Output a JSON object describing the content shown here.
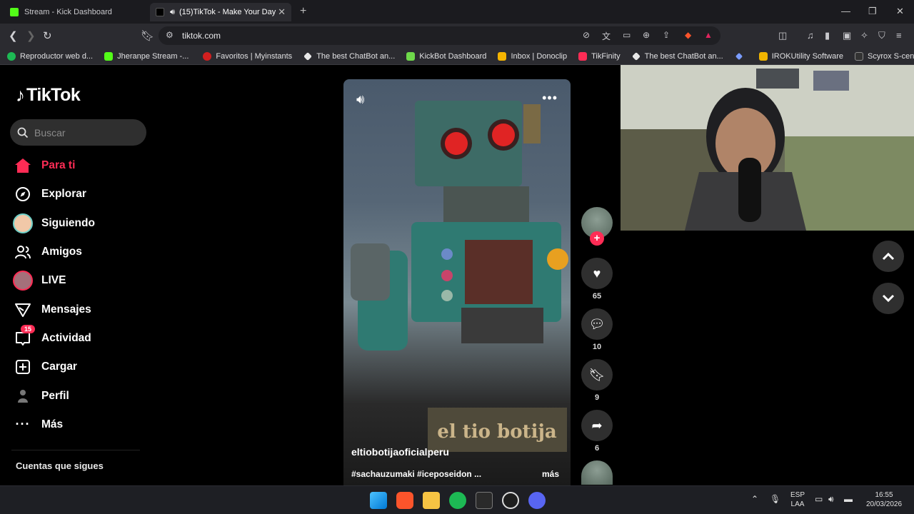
{
  "browser": {
    "tabs": [
      {
        "title": "Stream - Kick Dashboard",
        "icon": "kick-icon",
        "color": "#53fc18"
      },
      {
        "title": "(15)TikTok - Make Your Day",
        "icon": "tiktok-icon",
        "audio": true,
        "color": "#ffffff"
      }
    ],
    "address": "tiktok.com",
    "bookmarks": [
      {
        "label": "Reproductor web d...",
        "color": "#1db954"
      },
      {
        "label": "Jheranpe Stream -...",
        "color": "#53fc18"
      },
      {
        "label": "Favoritos | Myinstants",
        "color": "#d11f1f"
      },
      {
        "label": "The best ChatBot an...",
        "color": "#e8e8e8"
      },
      {
        "label": "KickBot Dashboard",
        "color": "#6ed94a"
      },
      {
        "label": "Inbox | Donoclip",
        "color": "#f5b400"
      },
      {
        "label": "TikFinity",
        "color": "#fe2c55"
      },
      {
        "label": "The best ChatBot an...",
        "color": "#e8e8e8"
      },
      {
        "label": "",
        "color": "#7a9cff"
      },
      {
        "label": "IROKUtility Software",
        "color": "#f0b400"
      },
      {
        "label": "Scyrox S-center",
        "color": "#333333"
      }
    ]
  },
  "tiktok": {
    "logo": "TikTok",
    "search_placeholder": "Buscar",
    "nav": [
      {
        "label": "Para ti",
        "icon": "home-icon",
        "active": true
      },
      {
        "label": "Explorar",
        "icon": "compass-icon"
      },
      {
        "label": "Siguiendo",
        "icon": "following-avatar-icon"
      },
      {
        "label": "Amigos",
        "icon": "friends-icon"
      },
      {
        "label": "LIVE",
        "icon": "live-avatar-icon"
      },
      {
        "label": "Mensajes",
        "icon": "send-icon"
      },
      {
        "label": "Actividad",
        "icon": "inbox-icon",
        "badge": "15"
      },
      {
        "label": "Cargar",
        "icon": "upload-icon"
      },
      {
        "label": "Perfil",
        "icon": "profile-icon"
      },
      {
        "label": "Más",
        "icon": "more-icon"
      }
    ],
    "following_title": "Cuentas que sigues",
    "accent": "#fe2c55"
  },
  "video": {
    "username": "eltiobotijaoficialperu",
    "caption": "#sachauzumaki #iceposeidon ...",
    "more_label": "más",
    "overlay_text": "el tio botija",
    "likes": "65",
    "comments": "10",
    "saves": "9",
    "shares": "6"
  },
  "taskbar": {
    "lang_top": "ESP",
    "lang_bottom": "LAA",
    "time": "16:55",
    "date": "20/03/2026"
  }
}
